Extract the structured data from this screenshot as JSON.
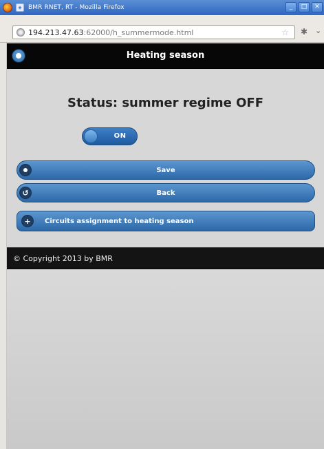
{
  "window": {
    "title": "BMR RNET, RT - Mozilla Firefox",
    "controls": {
      "minimize": "_",
      "maximize": "□",
      "close": "✕"
    }
  },
  "address_bar": {
    "url_host": "194.213.47.63",
    "url_rest": ":62000/h_summermode.html"
  },
  "header": {
    "title": "Heating season"
  },
  "main": {
    "status_text": "Status: summer regime OFF",
    "toggle": {
      "label": "ON"
    },
    "buttons": {
      "save": "Save",
      "back": "Back",
      "circuits": "Circuits assignment to heating season"
    },
    "icons": {
      "save": "gear-icon",
      "back": "back-arrow-icon",
      "circuits": "plus-icon",
      "header_home": "home-icon"
    }
  },
  "footer": {
    "copyright": "© Copyright 2013 by BMR"
  },
  "colors": {
    "accent": "#2d69a8",
    "header_bg": "#070707",
    "page_bg": "#d7d7d7"
  }
}
